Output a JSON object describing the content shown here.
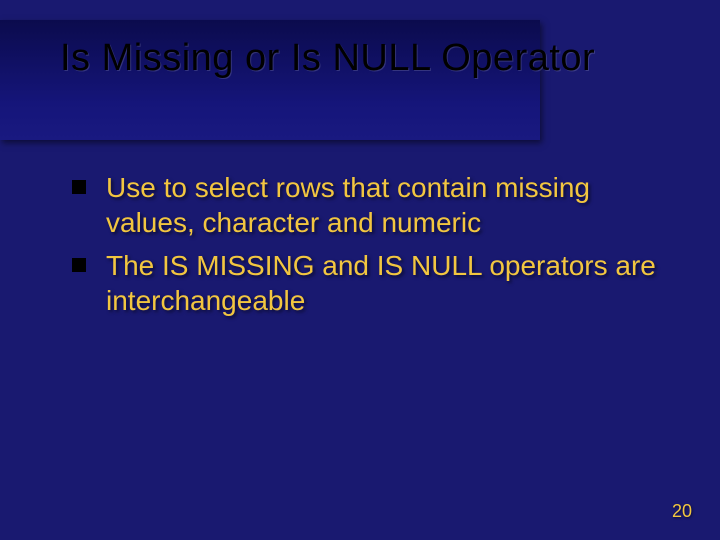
{
  "title": "Is Missing or Is NULL Operator",
  "bullets": [
    "Use to select rows that contain missing values, character and numeric",
    "The IS MISSING and IS NULL operators are interchangeable"
  ],
  "page_number": "20"
}
